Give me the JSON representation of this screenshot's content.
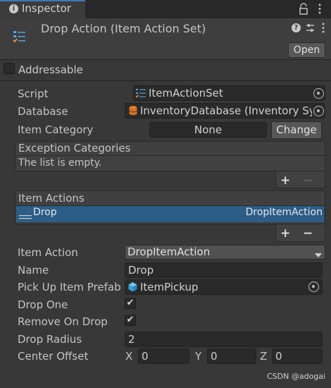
{
  "tab": {
    "title": "Inspector",
    "info_icon": "i"
  },
  "header": {
    "title": "Drop Action (Item Action Set)",
    "open_label": "Open"
  },
  "addressable": {
    "label": "Addressable"
  },
  "fields": {
    "script": {
      "label": "Script",
      "value": "ItemActionSet"
    },
    "database": {
      "label": "Database",
      "value": "InventoryDatabase (Inventory Sys"
    },
    "item_category": {
      "label": "Item Category",
      "value": "None",
      "button": "Change"
    }
  },
  "exception_list": {
    "header": "Exception Categories",
    "empty_text": "The list is empty.",
    "add": "+",
    "remove": "−"
  },
  "item_actions": {
    "header": "Item Actions",
    "row_name": "Drop",
    "row_type": "DropItemAction",
    "add": "+",
    "remove": "−"
  },
  "action": {
    "item_action": {
      "label": "Item Action",
      "value": "DropItemAction"
    },
    "name": {
      "label": "Name",
      "value": "Drop"
    },
    "prefab": {
      "label": "Pick Up Item Prefab",
      "value": "ItemPickup"
    },
    "drop_one": {
      "label": "Drop One",
      "check": "✔"
    },
    "remove_on_drop": {
      "label": "Remove On Drop",
      "check": "✔"
    },
    "drop_radius": {
      "label": "Drop Radius",
      "value": "2"
    },
    "center_offset": {
      "label": "Center Offset",
      "x_label": "X",
      "x": "0",
      "y_label": "Y",
      "y": "0",
      "z_label": "Z",
      "z": "0"
    }
  },
  "watermark": "CSDN @adogai"
}
